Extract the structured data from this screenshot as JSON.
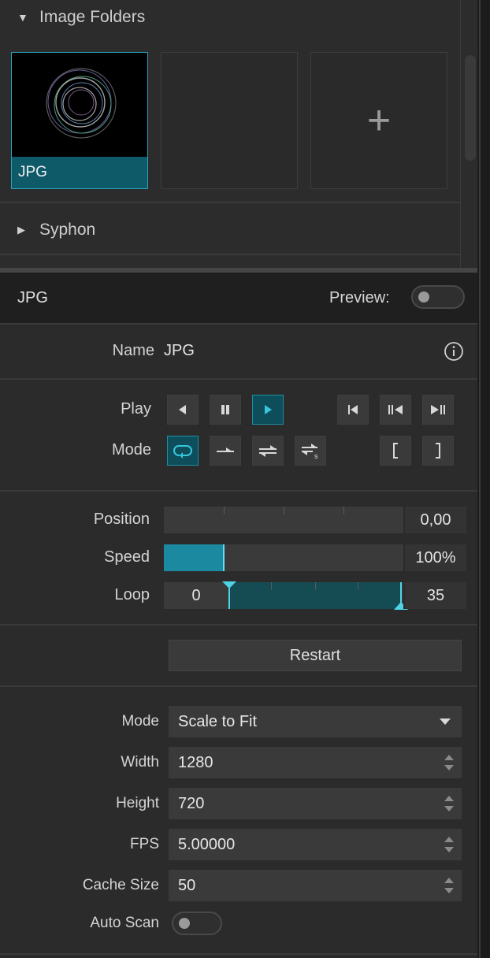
{
  "browser": {
    "image_folders_label": "Image Folders",
    "syphon_label": "Syphon",
    "thumbnails": [
      {
        "caption": "JPG",
        "selected": true
      },
      {
        "caption": "",
        "selected": false
      },
      {
        "caption": "+",
        "selected": false,
        "is_add": true
      }
    ]
  },
  "header": {
    "title": "JPG",
    "preview_label": "Preview:",
    "preview_on": false
  },
  "name_row": {
    "label": "Name",
    "value": "JPG"
  },
  "transport": {
    "play_label": "Play",
    "mode_label": "Mode",
    "play_active": "play-forward",
    "mode_active": "loop"
  },
  "playback": {
    "position_label": "Position",
    "position_value": "0,00",
    "position_fraction": 0,
    "speed_label": "Speed",
    "speed_value": "100%",
    "speed_fraction": 0.25,
    "loop_label": "Loop",
    "loop_start": "0",
    "loop_end": "35"
  },
  "restart_label": "Restart",
  "settings": {
    "mode_label": "Mode",
    "mode_value": "Scale to Fit",
    "width_label": "Width",
    "width_value": "1280",
    "height_label": "Height",
    "height_value": "720",
    "fps_label": "FPS",
    "fps_value": "5.00000",
    "cache_label": "Cache Size",
    "cache_value": "50",
    "autoscan_label": "Auto Scan",
    "autoscan_on": false
  },
  "colors": {
    "accent": "#1b8aa0",
    "accent_bright": "#4fd3e6",
    "selection_caption": "#0e5a68"
  }
}
